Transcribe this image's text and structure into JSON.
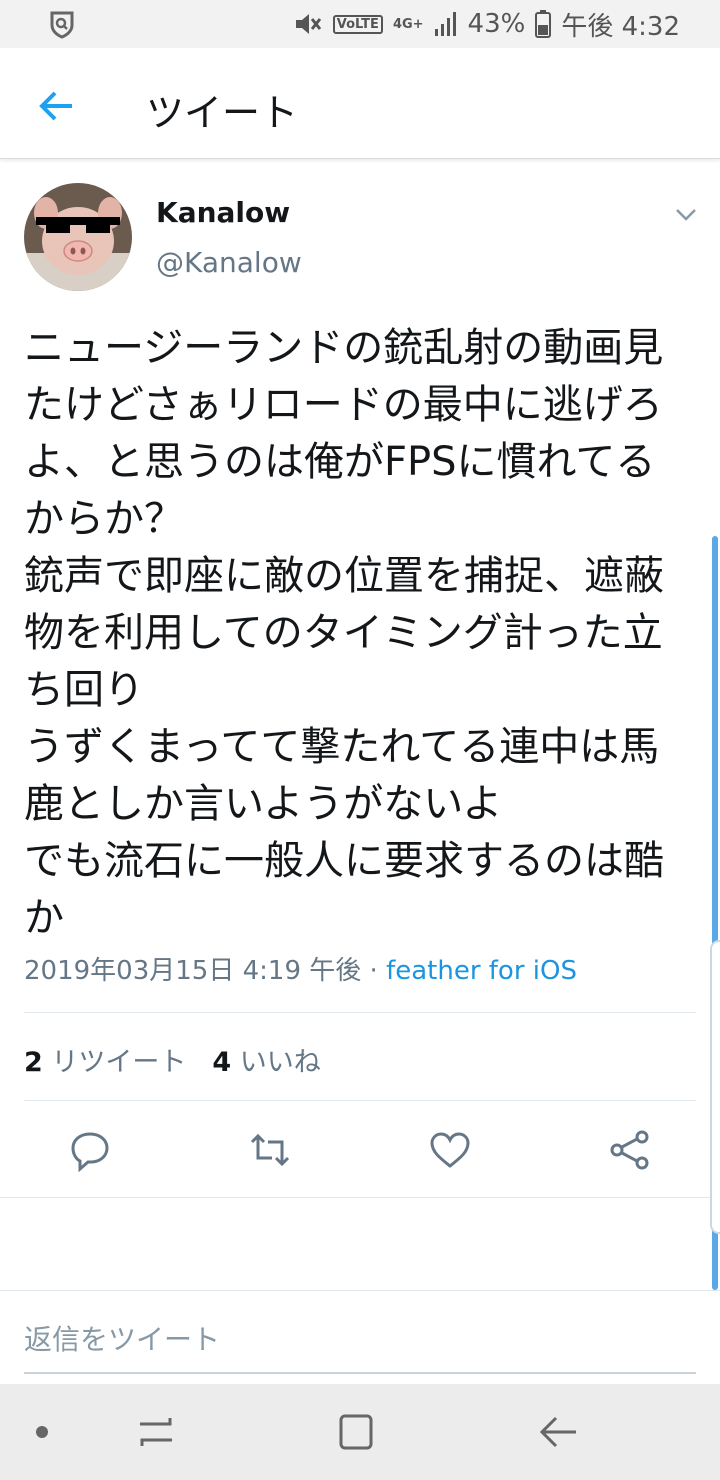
{
  "status_bar": {
    "battery": "43%",
    "time": "午後 4:32",
    "network": "4G+",
    "volte": "VoLTE",
    "icons": [
      "shield-icon",
      "mute-icon",
      "signal-icon",
      "battery-icon"
    ]
  },
  "app_bar": {
    "title": "ツイート",
    "back_icon": "arrow-left-icon"
  },
  "tweet": {
    "display_name": "Kanalow",
    "handle": "@Kanalow",
    "text": "ニュージーランドの銃乱射の動画見\nたけどさぁリロードの最中に逃げろ\nよ、と思うのは俺がFPSに慣れてる\nからか？\n銃声で即座に敵の位置を捕捉、遮蔽\n物を利用してのタイミング計った立\nち回り\nうずくまってて撃たれてる連中は馬\n鹿としか言いようがないよ\nでも流石に一般人に要求するのは酷\nか",
    "timestamp": "2019年03月15日 4:19 午後",
    "separator": " · ",
    "client": "feather for iOS",
    "retweet_count": "2",
    "retweet_label": "リツイート",
    "like_count": "4",
    "like_label": "いいね"
  },
  "actions": [
    "reply-icon",
    "retweet-icon",
    "like-icon",
    "share-icon"
  ],
  "reply": {
    "placeholder": "返信をツイート"
  },
  "colors": {
    "accent": "#1da1f2",
    "link": "#1b95e0",
    "secondary_text": "#657786",
    "primary_text": "#14171a"
  }
}
